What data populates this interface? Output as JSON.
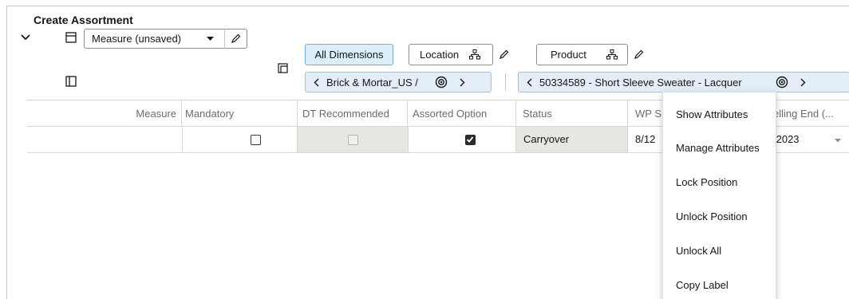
{
  "title": "Create Assortment",
  "toolbar": {
    "measure_select": "Measure (unsaved)",
    "all_dimensions": "All Dimensions",
    "location_label": "Location",
    "product_label": "Product",
    "location_crumb": "Brick & Mortar_US /",
    "product_crumb": "50334589 - Short Sleeve Sweater - Lacquer"
  },
  "table": {
    "headers": {
      "measure": "Measure",
      "mandatory": "Mandatory",
      "dt_recommended": "DT Recommended",
      "assorted_option": "Assorted Option",
      "status": "Status",
      "wp_start": "WP S",
      "selling_end": "elling End (..."
    },
    "rows": [
      {
        "mandatory": false,
        "dt_recommended": false,
        "assorted_option": true,
        "status": "Carryover",
        "wp_start": "8/12",
        "selling_end": "/2023"
      }
    ]
  },
  "context_menu": {
    "items": [
      "Show Attributes",
      "Manage Attributes",
      "Lock Position",
      "Unlock Position",
      "Unlock All",
      "Copy Label"
    ]
  },
  "colors": {
    "accent_bg": "#dceefa",
    "grid_border": "#dad7d3",
    "disabled_cell": "#e8e6e3"
  }
}
